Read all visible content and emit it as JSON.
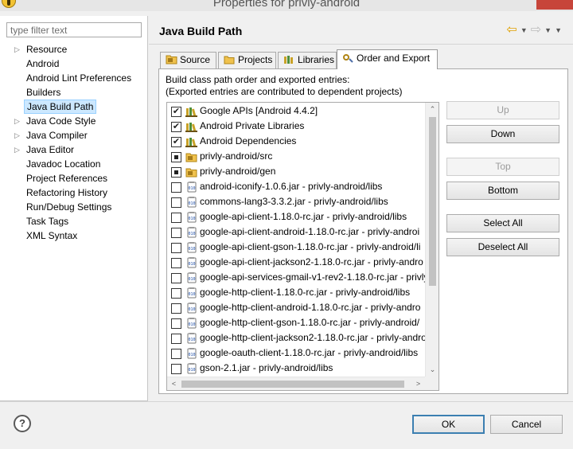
{
  "window": {
    "title": "Properties for privly-android"
  },
  "filter": {
    "placeholder": "type filter text",
    "value": ""
  },
  "nav": {
    "items": [
      {
        "label": "Resource",
        "expandable": true,
        "selected": false
      },
      {
        "label": "Android",
        "expandable": false,
        "selected": false
      },
      {
        "label": "Android Lint Preferences",
        "expandable": false,
        "selected": false
      },
      {
        "label": "Builders",
        "expandable": false,
        "selected": false
      },
      {
        "label": "Java Build Path",
        "expandable": false,
        "selected": true
      },
      {
        "label": "Java Code Style",
        "expandable": true,
        "selected": false
      },
      {
        "label": "Java Compiler",
        "expandable": true,
        "selected": false
      },
      {
        "label": "Java Editor",
        "expandable": true,
        "selected": false
      },
      {
        "label": "Javadoc Location",
        "expandable": false,
        "selected": false
      },
      {
        "label": "Project References",
        "expandable": false,
        "selected": false
      },
      {
        "label": "Refactoring History",
        "expandable": false,
        "selected": false
      },
      {
        "label": "Run/Debug Settings",
        "expandable": false,
        "selected": false
      },
      {
        "label": "Task Tags",
        "expandable": false,
        "selected": false
      },
      {
        "label": "XML Syntax",
        "expandable": false,
        "selected": false
      }
    ]
  },
  "page": {
    "title": "Java Build Path"
  },
  "tabs": [
    {
      "label": "Source",
      "icon": "source-folder-icon",
      "active": false
    },
    {
      "label": "Projects",
      "icon": "projects-icon",
      "active": false
    },
    {
      "label": "Libraries",
      "icon": "libraries-icon",
      "active": false
    },
    {
      "label": "Order and Export",
      "icon": "order-export-icon",
      "active": true
    }
  ],
  "order_export": {
    "description_line1": "Build class path order and exported entries:",
    "description_line2": "(Exported entries are contributed to dependent projects)",
    "entries": [
      {
        "label": "Google APIs [Android 4.4.2]",
        "state": "checked",
        "icon": "library-icon"
      },
      {
        "label": "Android Private Libraries",
        "state": "checked",
        "icon": "library-icon"
      },
      {
        "label": "Android Dependencies",
        "state": "checked",
        "icon": "library-icon"
      },
      {
        "label": "privly-android/src",
        "state": "partial",
        "icon": "source-folder-icon"
      },
      {
        "label": "privly-android/gen",
        "state": "partial",
        "icon": "source-folder-icon"
      },
      {
        "label": "android-iconify-1.0.6.jar - privly-android/libs",
        "state": "unchecked",
        "icon": "jar-icon"
      },
      {
        "label": "commons-lang3-3.3.2.jar - privly-android/libs",
        "state": "unchecked",
        "icon": "jar-icon"
      },
      {
        "label": "google-api-client-1.18.0-rc.jar - privly-android/libs",
        "state": "unchecked",
        "icon": "jar-icon"
      },
      {
        "label": "google-api-client-android-1.18.0-rc.jar - privly-androi",
        "state": "unchecked",
        "icon": "jar-icon"
      },
      {
        "label": "google-api-client-gson-1.18.0-rc.jar - privly-android/li",
        "state": "unchecked",
        "icon": "jar-icon"
      },
      {
        "label": "google-api-client-jackson2-1.18.0-rc.jar - privly-andro",
        "state": "unchecked",
        "icon": "jar-icon"
      },
      {
        "label": "google-api-services-gmail-v1-rev2-1.18.0-rc.jar - privly",
        "state": "unchecked",
        "icon": "jar-icon"
      },
      {
        "label": "google-http-client-1.18.0-rc.jar - privly-android/libs",
        "state": "unchecked",
        "icon": "jar-icon"
      },
      {
        "label": "google-http-client-android-1.18.0-rc.jar - privly-andro",
        "state": "unchecked",
        "icon": "jar-icon"
      },
      {
        "label": "google-http-client-gson-1.18.0-rc.jar - privly-android/",
        "state": "unchecked",
        "icon": "jar-icon"
      },
      {
        "label": "google-http-client-jackson2-1.18.0-rc.jar - privly-andro",
        "state": "unchecked",
        "icon": "jar-icon"
      },
      {
        "label": "google-oauth-client-1.18.0-rc.jar - privly-android/libs",
        "state": "unchecked",
        "icon": "jar-icon"
      },
      {
        "label": "gson-2.1.jar - privly-android/libs",
        "state": "unchecked",
        "icon": "jar-icon"
      }
    ],
    "buttons": {
      "up": "Up",
      "down": "Down",
      "top": "Top",
      "bottom": "Bottom",
      "select_all": "Select All",
      "deselect_all": "Deselect All"
    }
  },
  "dialog": {
    "ok": "OK",
    "cancel": "Cancel",
    "help": "?"
  },
  "colors": {
    "selection": "#cce8ff",
    "default_button_border": "#3c7fb1",
    "close_button": "#c7453a"
  }
}
